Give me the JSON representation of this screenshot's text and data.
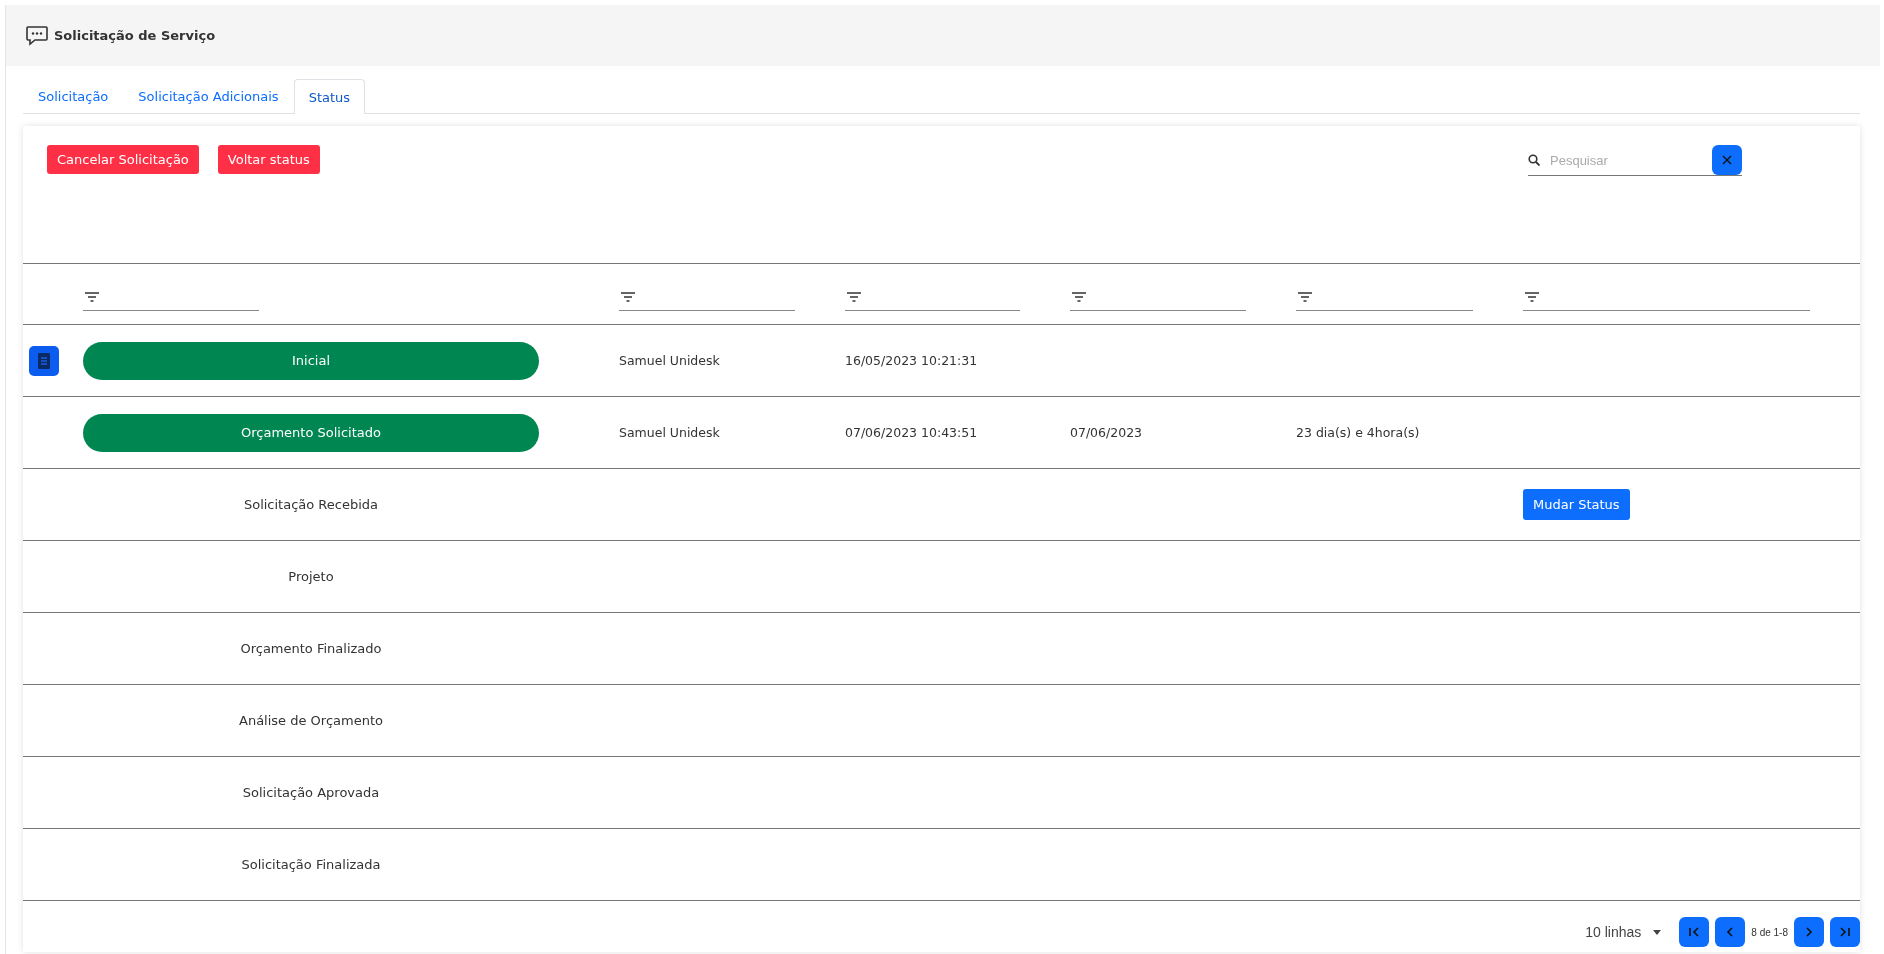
{
  "header": {
    "title": "Solicitação de Serviço"
  },
  "tabs": [
    {
      "label": "Solicitação",
      "selected": false
    },
    {
      "label": "Solicitação Adicionais",
      "selected": false
    },
    {
      "label": "Status",
      "selected": true
    }
  ],
  "actions": [
    "Cancelar Solicitação",
    "Voltar status"
  ],
  "search": {
    "placeholder": "Pesquisar"
  },
  "table": {
    "rows": [
      {
        "kind": "done",
        "status": "Inicial",
        "details": true,
        "user": "Samuel Unidesk",
        "created": "16/05/2023 10:21:31"
      },
      {
        "kind": "done",
        "status": "Orçamento Solicitado",
        "details": false,
        "user": "Samuel Unidesk",
        "created": "07/06/2023 10:43:51",
        "date": "07/06/2023",
        "duration": "23 dia(s) e 4hora(s)"
      },
      {
        "kind": "pending",
        "status": "Solicitação Recebida",
        "details": false,
        "action": "Mudar Status"
      },
      {
        "kind": "pending",
        "status": "Projeto",
        "details": false
      },
      {
        "kind": "pending",
        "status": "Orçamento Finalizado",
        "details": false
      },
      {
        "kind": "pending",
        "status": "Análise de Orçamento",
        "details": false
      },
      {
        "kind": "pending",
        "status": "Solicitação Aprovada",
        "details": false
      },
      {
        "kind": "pending",
        "status": "Solicitação Finalizada",
        "details": false
      }
    ]
  },
  "pagination": {
    "rows_per_page": "10 linhas",
    "range": "8 de 1-8"
  }
}
